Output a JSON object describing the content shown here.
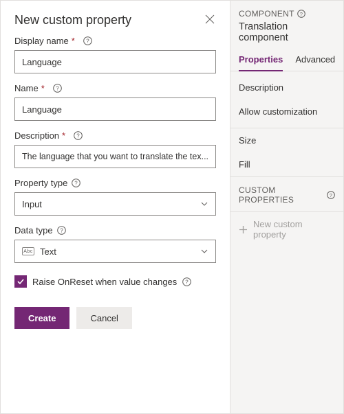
{
  "dialog": {
    "title": "New custom property",
    "fields": {
      "displayName": {
        "label": "Display name",
        "value": "Language",
        "required": true
      },
      "name": {
        "label": "Name",
        "value": "Language",
        "required": true
      },
      "description": {
        "label": "Description",
        "value": "The language that you want to translate the tex...",
        "required": true
      },
      "propertyType": {
        "label": "Property type",
        "value": "Input"
      },
      "dataType": {
        "label": "Data type",
        "value": "Text",
        "iconText": "Abc"
      }
    },
    "checkbox": {
      "label": "Raise OnReset when value changes",
      "checked": true
    },
    "buttons": {
      "create": "Create",
      "cancel": "Cancel"
    }
  },
  "rightPane": {
    "header": "COMPONENT",
    "title": "Translation component",
    "tabs": {
      "properties": "Properties",
      "advanced": "Advanced"
    },
    "items": [
      "Description",
      "Allow customization",
      "Size",
      "Fill"
    ],
    "customSection": "CUSTOM PROPERTIES",
    "addNew": "New custom property"
  }
}
